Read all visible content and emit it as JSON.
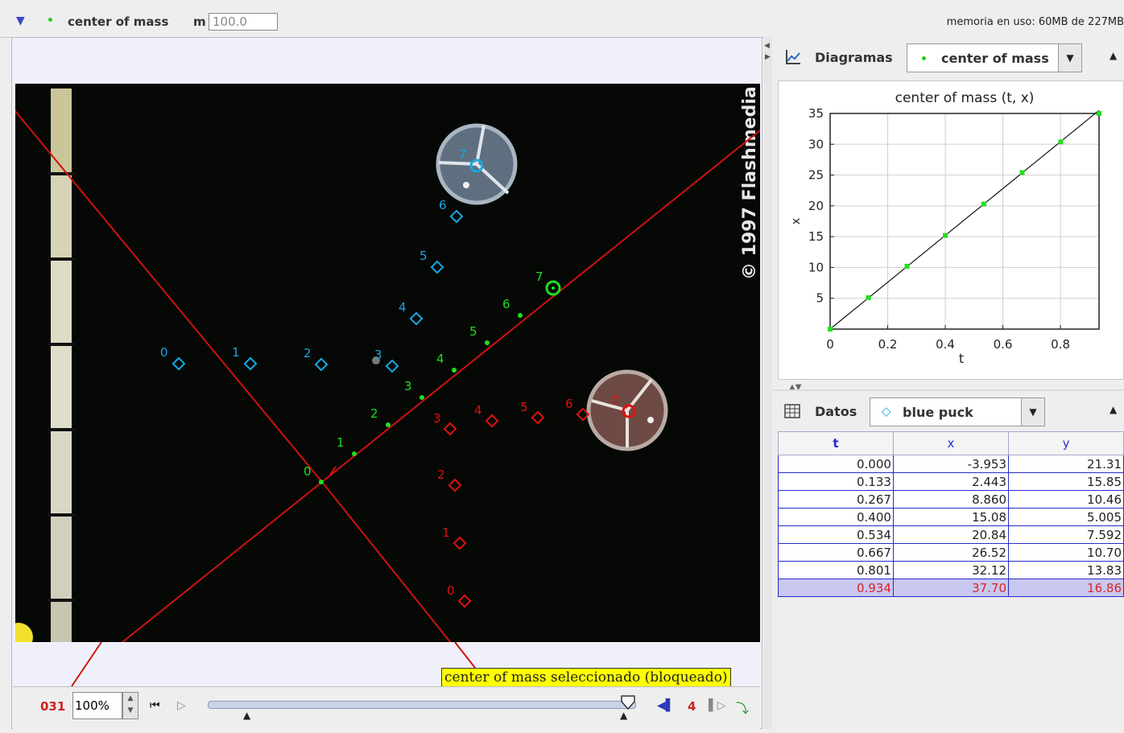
{
  "track": {
    "name": "center of mass",
    "mass_label": "m",
    "mass_value": "100.0",
    "memory": "memoria en uso: 60MB de 227MB"
  },
  "video": {
    "copyright": "© 1997 Flashmedia",
    "status": "center of mass seleccionado (bloqueado)",
    "frame": "031",
    "zoom": "100%",
    "step": "4",
    "slider_fraction": 1.0,
    "blue_labels": [
      "0",
      "1",
      "2",
      "3",
      "4",
      "5",
      "6",
      "7"
    ],
    "red_labels": [
      "0",
      "1",
      "2",
      "3",
      "4",
      "5",
      "6",
      "7"
    ],
    "green_labels": [
      "0",
      "1",
      "2",
      "3",
      "4",
      "5",
      "6",
      "7"
    ],
    "colors": {
      "blue": "#19a7e0",
      "red": "#e01010",
      "green": "#1ee01e",
      "axis": "#d01010"
    }
  },
  "plot_panel": {
    "label": "Diagramas",
    "track_selected": "center of mass"
  },
  "table_panel": {
    "label": "Datos",
    "track_selected": "blue puck",
    "columns": [
      "t",
      "x",
      "y"
    ],
    "rows": [
      [
        "0.000",
        "-3.953",
        "21.31"
      ],
      [
        "0.133",
        "2.443",
        "15.85"
      ],
      [
        "0.267",
        "8.860",
        "10.46"
      ],
      [
        "0.400",
        "15.08",
        "5.005"
      ],
      [
        "0.534",
        "20.84",
        "7.592"
      ],
      [
        "0.667",
        "26.52",
        "10.70"
      ],
      [
        "0.801",
        "32.12",
        "13.83"
      ],
      [
        "0.934",
        "37.70",
        "16.86"
      ]
    ],
    "selected_row": 7
  },
  "chart_data": {
    "type": "scatter",
    "title": "center of mass (t, x)",
    "xlabel": "t",
    "ylabel": "x",
    "xlim": [
      0,
      0.934
    ],
    "ylim": [
      0,
      35
    ],
    "xticks": [
      "0",
      "0.2",
      "0.4",
      "0.6",
      "0.8"
    ],
    "xtick_values": [
      0,
      0.2,
      0.4,
      0.6,
      0.8
    ],
    "yticks": [
      "5",
      "10",
      "15",
      "20",
      "25",
      "30",
      "35"
    ],
    "ytick_values": [
      5,
      10,
      15,
      20,
      25,
      30,
      35
    ],
    "grid": true,
    "x": [
      0.0,
      0.133,
      0.267,
      0.4,
      0.534,
      0.667,
      0.801,
      0.934
    ],
    "y": [
      0.0,
      5.1,
      10.2,
      15.2,
      20.3,
      25.4,
      30.4,
      35.5
    ],
    "point_color": "#1ee01e"
  }
}
